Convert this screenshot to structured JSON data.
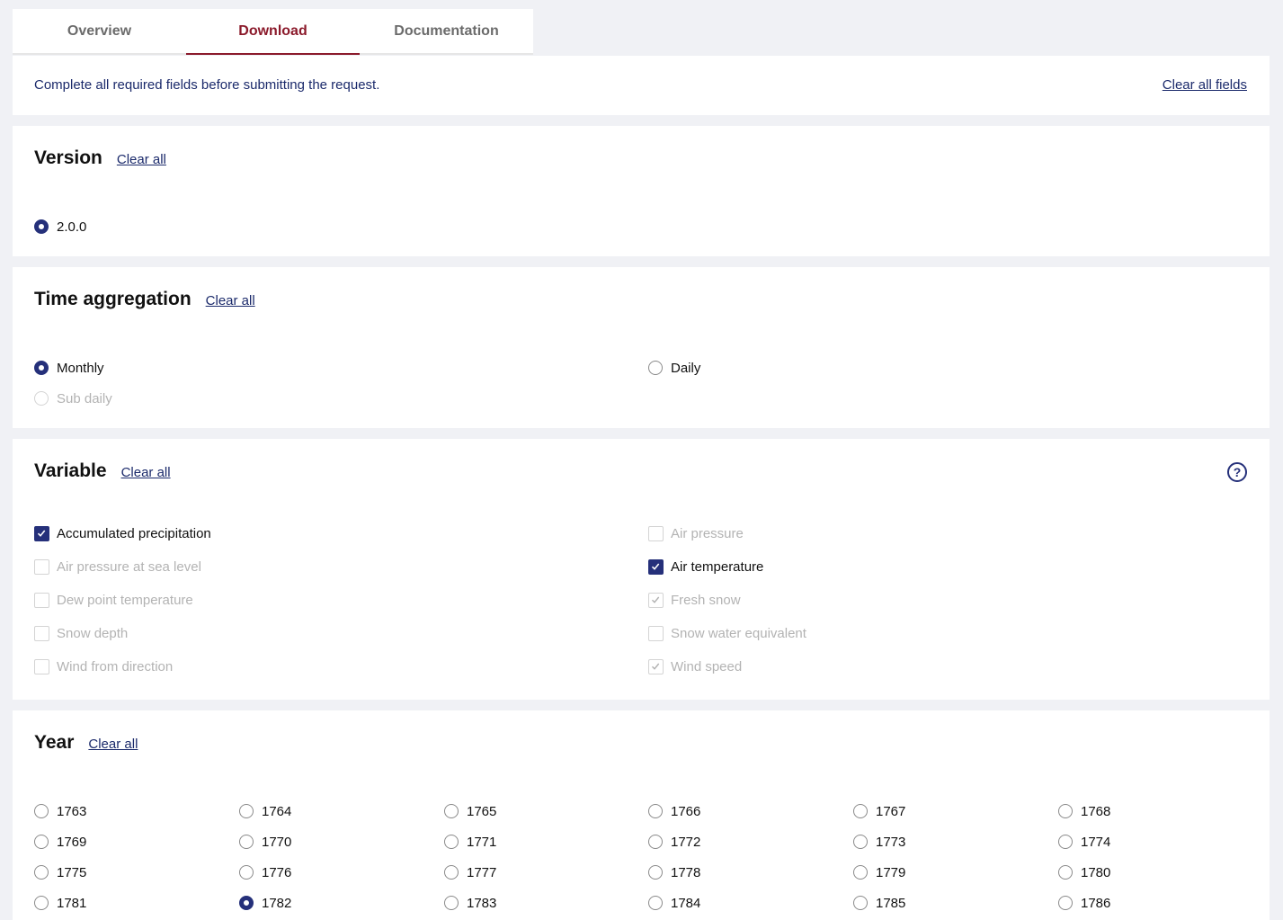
{
  "tabs": [
    {
      "label": "Overview",
      "active": false
    },
    {
      "label": "Download",
      "active": true
    },
    {
      "label": "Documentation",
      "active": false
    }
  ],
  "notice": {
    "text": "Complete all required fields before submitting the request.",
    "clear_all_fields": "Clear all fields"
  },
  "clear_all_label": "Clear all",
  "version": {
    "title": "Version",
    "options": [
      {
        "label": "2.0.0",
        "checked": true,
        "disabled": false
      }
    ]
  },
  "time_aggregation": {
    "title": "Time aggregation",
    "options": [
      {
        "label": "Monthly",
        "checked": true,
        "disabled": false
      },
      {
        "label": "Daily",
        "checked": false,
        "disabled": false
      },
      {
        "label": "Sub daily",
        "checked": false,
        "disabled": true
      }
    ]
  },
  "variable": {
    "title": "Variable",
    "help_icon": "question-circle-icon",
    "options": [
      {
        "label": "Accumulated precipitation",
        "checked": true,
        "disabled": false
      },
      {
        "label": "Air pressure",
        "checked": false,
        "disabled": true
      },
      {
        "label": "Air pressure at sea level",
        "checked": false,
        "disabled": true
      },
      {
        "label": "Air temperature",
        "checked": true,
        "disabled": false
      },
      {
        "label": "Dew point temperature",
        "checked": false,
        "disabled": true
      },
      {
        "label": "Fresh snow",
        "checked": true,
        "disabled": true
      },
      {
        "label": "Snow depth",
        "checked": false,
        "disabled": true
      },
      {
        "label": "Snow water equivalent",
        "checked": false,
        "disabled": true
      },
      {
        "label": "Wind from direction",
        "checked": false,
        "disabled": true
      },
      {
        "label": "Wind speed",
        "checked": true,
        "disabled": true
      }
    ]
  },
  "year": {
    "title": "Year",
    "options": [
      {
        "label": "1763",
        "checked": false
      },
      {
        "label": "1764",
        "checked": false
      },
      {
        "label": "1765",
        "checked": false
      },
      {
        "label": "1766",
        "checked": false
      },
      {
        "label": "1767",
        "checked": false
      },
      {
        "label": "1768",
        "checked": false
      },
      {
        "label": "1769",
        "checked": false
      },
      {
        "label": "1770",
        "checked": false
      },
      {
        "label": "1771",
        "checked": false
      },
      {
        "label": "1772",
        "checked": false
      },
      {
        "label": "1773",
        "checked": false
      },
      {
        "label": "1774",
        "checked": false
      },
      {
        "label": "1775",
        "checked": false
      },
      {
        "label": "1776",
        "checked": false
      },
      {
        "label": "1777",
        "checked": false
      },
      {
        "label": "1778",
        "checked": false
      },
      {
        "label": "1779",
        "checked": false
      },
      {
        "label": "1780",
        "checked": false
      },
      {
        "label": "1781",
        "checked": false
      },
      {
        "label": "1782",
        "checked": true
      },
      {
        "label": "1783",
        "checked": false
      },
      {
        "label": "1784",
        "checked": false
      },
      {
        "label": "1785",
        "checked": false
      },
      {
        "label": "1786",
        "checked": false
      }
    ]
  },
  "colors": {
    "accent": "#25307a",
    "active_tab": "#8b1a2b",
    "link": "#1b2a6b",
    "background": "#f0f1f5"
  }
}
